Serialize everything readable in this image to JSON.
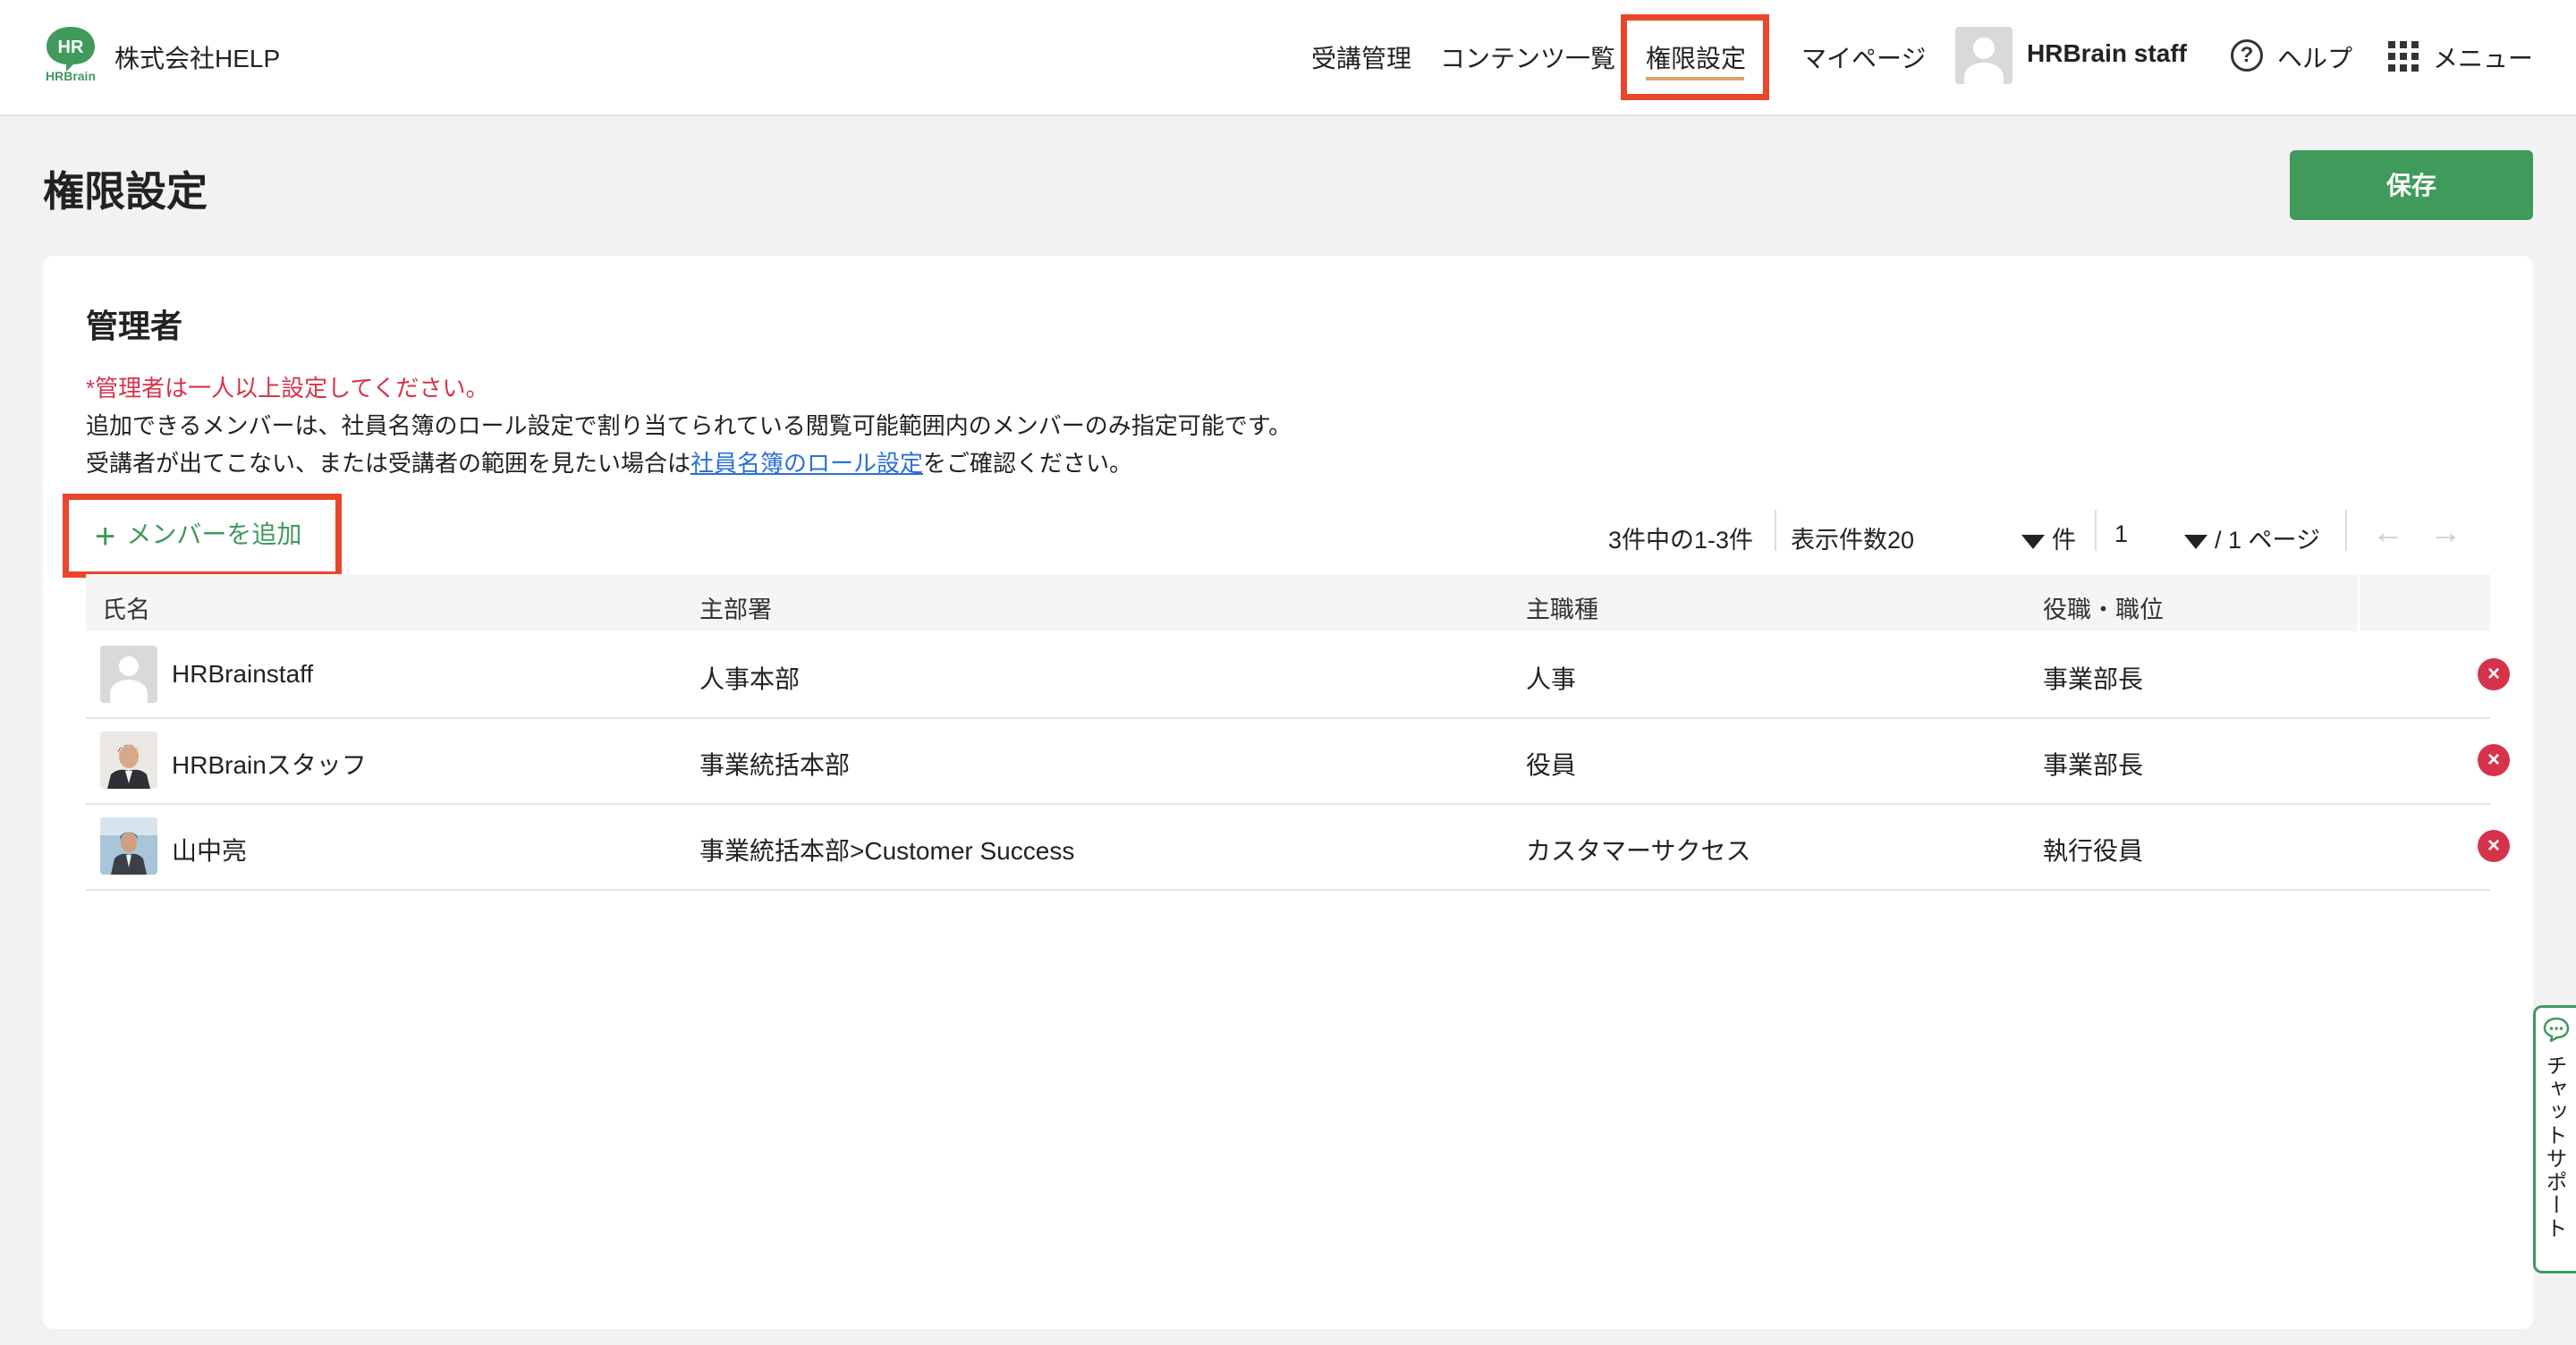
{
  "header": {
    "logo_text_top": "HR",
    "logo_text_bottom": "HRBrain",
    "company": "株式会社HELP",
    "nav": [
      {
        "label": "受講管理"
      },
      {
        "label": "コンテンツ一覧"
      },
      {
        "label": "権限設定"
      },
      {
        "label": "マイページ"
      }
    ],
    "user_name": "HRBrain staff",
    "help_label": "ヘルプ",
    "menu_label": "メニュー"
  },
  "page": {
    "title": "権限設定",
    "save_label": "保存"
  },
  "section": {
    "title": "管理者",
    "notice_required": "*管理者は一人以上設定してください。",
    "notice_line2": "追加できるメンバーは、社員名簿のロール設定で割り当てられている閲覧可能範囲内のメンバーのみ指定可能です。",
    "notice_line3_pre": "受講者が出てこない、または受講者の範囲を見たい場合は",
    "notice_line3_link": "社員名簿のロール設定",
    "notice_line3_post": "をご確認ください。",
    "add_member_label": "メンバーを追加"
  },
  "pagination": {
    "summary": "3件中の1-3件",
    "per_page_label": "表示件数20",
    "per_page_unit": "件",
    "current_page": "1",
    "total_pages": "/ 1 ページ",
    "prev": "←",
    "next": "→"
  },
  "table": {
    "headers": [
      "氏名",
      "主部署",
      "主職種",
      "役職・職位"
    ],
    "rows": [
      {
        "name": "HRBrainstaff",
        "dept": "人事本部",
        "job": "人事",
        "position": "事業部長",
        "remove": "×"
      },
      {
        "name": "HRBrainスタッフ",
        "dept": "事業統括本部",
        "job": "役員",
        "position": "事業部長",
        "remove": "×"
      },
      {
        "name": "山中亮",
        "dept": "事業統括本部>Customer Success",
        "job": "カスタマーサクセス",
        "position": "執行役員",
        "remove": "×"
      }
    ]
  },
  "chat_support": {
    "label": "チャットサポート",
    "icon": "chat-bubble-icon"
  },
  "colors": {
    "accent_green": "#3f9a5c",
    "highlight_red": "#e8472b",
    "remove_red": "#d6334a",
    "link_blue": "#2a6fd6"
  }
}
